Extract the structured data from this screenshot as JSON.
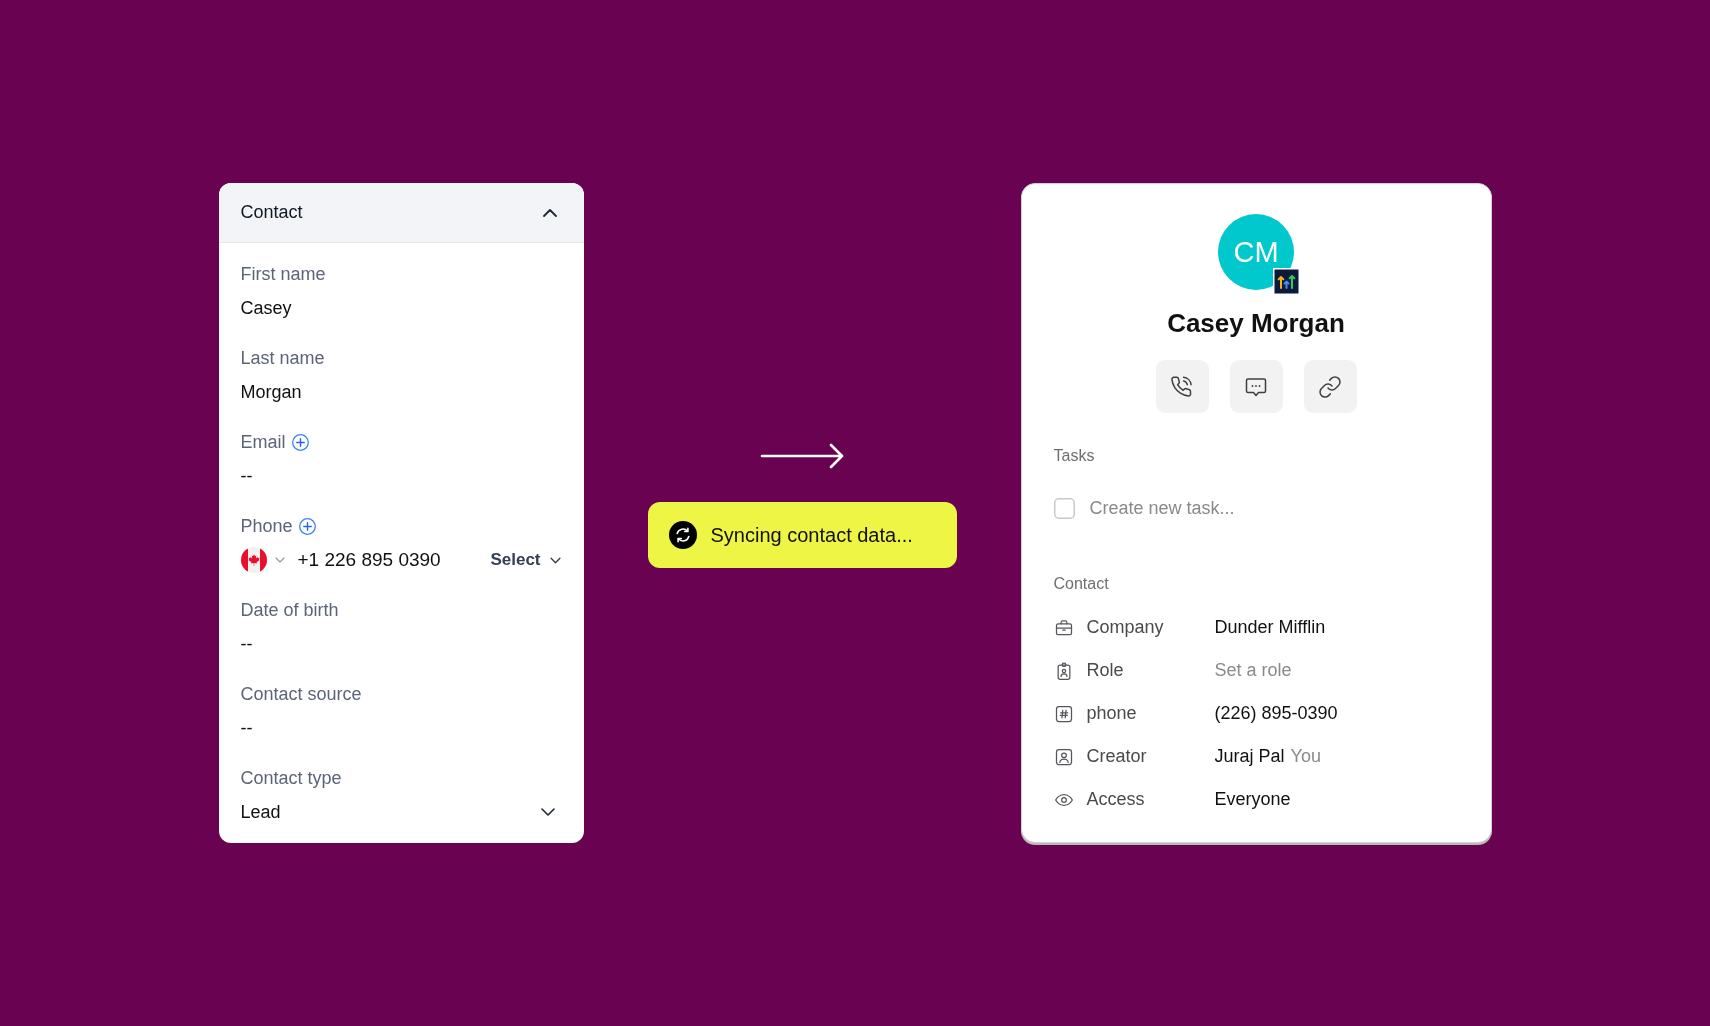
{
  "contact_panel": {
    "title": "Contact",
    "expanded": true,
    "fields": [
      {
        "kind": "text",
        "label": "First name",
        "add_button": false,
        "value": "Casey"
      },
      {
        "kind": "text",
        "label": "Last name",
        "add_button": false,
        "value": "Morgan"
      },
      {
        "kind": "text",
        "label": "Email",
        "add_button": true,
        "value": "--"
      },
      {
        "kind": "phone",
        "label": "Phone",
        "add_button": true,
        "value": "+1 226 895 0390",
        "type_label": "Select"
      },
      {
        "kind": "text",
        "label": "Date of birth",
        "add_button": false,
        "value": "--"
      },
      {
        "kind": "text",
        "label": "Contact source",
        "add_button": false,
        "value": "--"
      },
      {
        "kind": "select",
        "label": "Contact type",
        "add_button": false,
        "value": "Lead"
      }
    ]
  },
  "sync_toast": {
    "text": "Syncing contact data..."
  },
  "contact_card": {
    "avatar_initials": "CM",
    "name": "Casey Morgan",
    "tasks": {
      "title": "Tasks",
      "new_task": {
        "checked": false,
        "placeholder": "Create new task..."
      }
    },
    "details": {
      "title": "Contact",
      "rows": [
        {
          "label": "Company",
          "value": "Dunder Mifflin"
        },
        {
          "label": "Role",
          "placeholder": "Set a role"
        },
        {
          "label": "phone",
          "value": "(226) 895-0390"
        },
        {
          "label": "Creator",
          "value": "Juraj Pal",
          "note": "You"
        },
        {
          "label": "Access",
          "value": "Everyone"
        }
      ]
    }
  }
}
